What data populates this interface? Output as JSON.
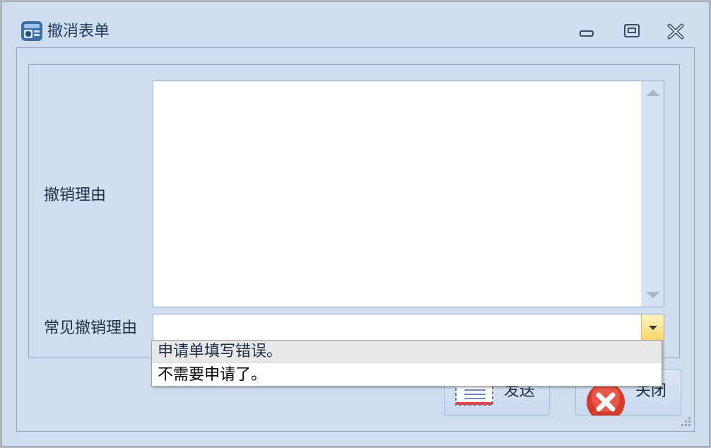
{
  "window": {
    "title": "撤消表单",
    "icon": "form-app-icon",
    "controls": [
      "minimize-icon",
      "maximize-icon",
      "close-icon"
    ]
  },
  "form": {
    "reason_label": "撤销理由",
    "reason_value": "",
    "common_reason_label": "常见撤销理由",
    "common_reason_value": ""
  },
  "dropdown": {
    "options": [
      "申请单填写错误。",
      "不需要申请了。"
    ],
    "highlighted_index": 0
  },
  "buttons": {
    "send_label": "发送",
    "send_icon": "envelope-icon",
    "close_label": "关闭",
    "close_icon": "red-x-icon"
  },
  "colors": {
    "window_bg": "#cfddef",
    "border": "#8ea6c4",
    "combo_button": "#ffd36a"
  }
}
